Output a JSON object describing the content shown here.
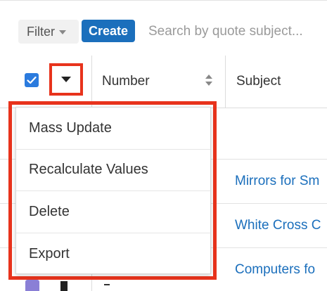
{
  "toolbar": {
    "filter_label": "Filter",
    "create_label": "Create",
    "search_placeholder": "Search by quote subject..."
  },
  "table": {
    "columns": [
      {
        "label": "Number"
      },
      {
        "label": "Subject"
      }
    ],
    "rows": [
      {
        "subject": "Mirrors for Sm"
      },
      {
        "subject": "White Cross C"
      },
      {
        "subject": "Computers fo"
      }
    ]
  },
  "actions_menu": {
    "items": [
      {
        "label": "Mass Update"
      },
      {
        "label": "Recalculate Values"
      },
      {
        "label": "Delete"
      },
      {
        "label": "Export"
      }
    ]
  },
  "colors": {
    "accent": "#1b6fbc",
    "checkbox": "#2b7bde",
    "highlight": "#e8331c"
  },
  "icons": {
    "filter_caret": "caret-down-icon",
    "select_all_caret": "caret-down-icon",
    "sort": "sort-icon",
    "check": "check-icon"
  }
}
